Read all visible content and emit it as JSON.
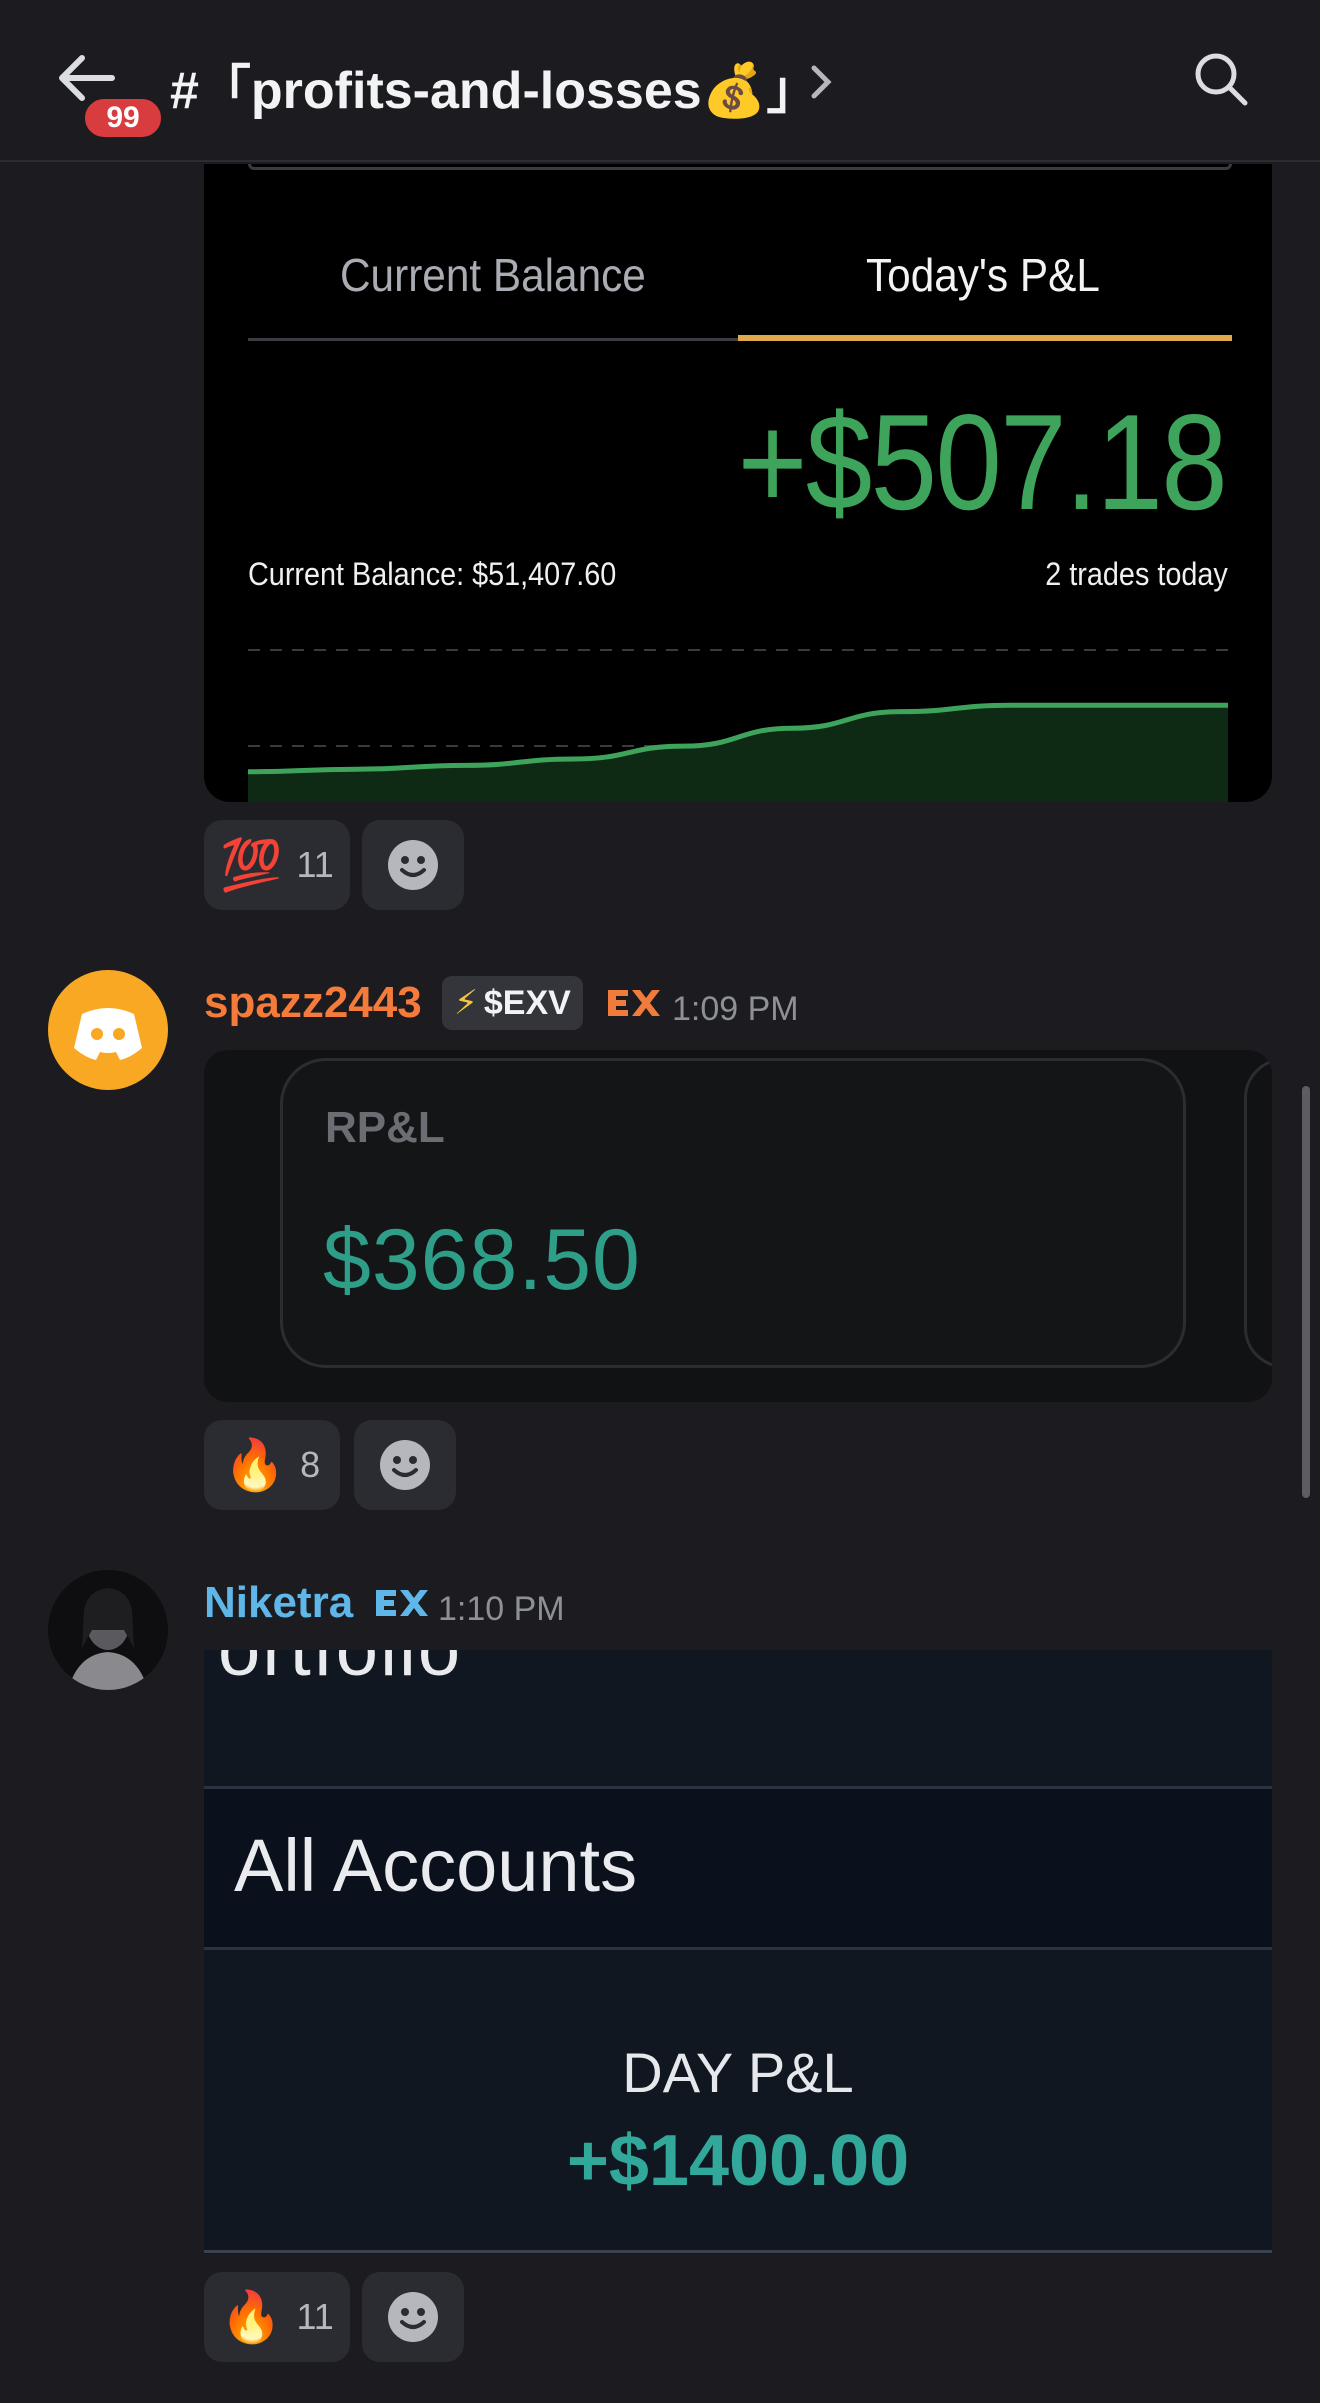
{
  "header": {
    "badge": "99",
    "channel": "#「profits-and-losses💰」"
  },
  "messages": [
    {
      "embed": {
        "tab_balance": "Current Balance",
        "tab_pnl": "Today's P&L",
        "pnl": "+$507.18",
        "current_balance": "Current Balance: $51,407.60",
        "trades": "2 trades today",
        "sparkline": [
          0.08,
          0.1,
          0.13,
          0.18,
          0.28,
          0.42,
          0.55,
          0.6,
          0.6,
          0.6
        ]
      },
      "reactions": [
        {
          "emoji": "💯",
          "count": "11"
        }
      ]
    },
    {
      "author": "spazz2443",
      "author_color": "#f47b3a",
      "tag": "$EXV",
      "time": "1:09 PM",
      "embed": {
        "label": "RP&L",
        "value": "$368.50"
      },
      "reactions": [
        {
          "emoji": "🔥",
          "count": "8"
        }
      ]
    },
    {
      "author": "Niketra",
      "author_color": "#5fb6e8",
      "time": "1:10 PM",
      "embed": {
        "partial_heading": "ortfolio",
        "accounts": "All Accounts",
        "day_label": "DAY P&L",
        "day_value": "+$1400.00"
      },
      "reactions": [
        {
          "emoji": "🔥",
          "count": "11"
        }
      ]
    }
  ]
}
